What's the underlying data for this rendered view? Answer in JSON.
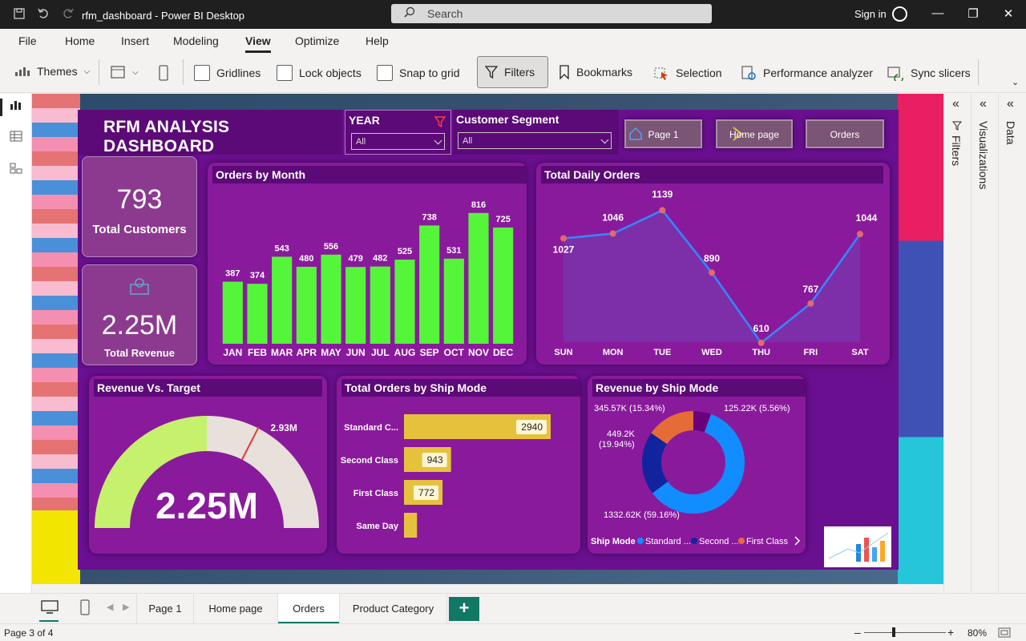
{
  "window": {
    "title": "rfm_dashboard - Power BI Desktop",
    "search_label": "Search",
    "signin_label": "Sign in"
  },
  "menu": [
    "File",
    "Home",
    "Insert",
    "Modeling",
    "View",
    "Optimize",
    "Help"
  ],
  "ribbon": {
    "themes": "Themes",
    "gridlines": "Gridlines",
    "lock_objects": "Lock objects",
    "snap_to_grid": "Snap to grid",
    "filters": "Filters",
    "bookmarks": "Bookmarks",
    "selection": "Selection",
    "performance": "Performance analyzer",
    "sync_slicers": "Sync slicers"
  },
  "report": {
    "title": "RFM ANALYSIS DASHBOARD",
    "year_slicer": {
      "label": "YEAR",
      "value": "All"
    },
    "segment_slicer": {
      "label": "Customer Segment",
      "value": "All"
    },
    "nav_buttons": [
      "Page 1",
      "Home page",
      "Orders"
    ],
    "kpi_customers": {
      "value": "793",
      "label": "Total Customers"
    },
    "kpi_revenue": {
      "value": "2.25M",
      "label": "Total Revenue"
    },
    "colors": {
      "bar_green": "#55f53a",
      "line_blue": "#3388ff",
      "gold": "#e6c23c",
      "panel": "#8a1a9c",
      "header": "#5c0a77"
    }
  },
  "chart_data": [
    {
      "type": "bar",
      "title": "Orders by Month",
      "categories": [
        "JAN",
        "FEB",
        "MAR",
        "APR",
        "MAY",
        "JUN",
        "JUL",
        "AUG",
        "SEP",
        "OCT",
        "NOV",
        "DEC"
      ],
      "values": [
        387,
        374,
        543,
        480,
        556,
        479,
        482,
        525,
        738,
        531,
        816,
        725
      ],
      "ylim": [
        0,
        850
      ]
    },
    {
      "type": "area",
      "title": "Total Daily Orders",
      "categories": [
        "SUN",
        "MON",
        "TUE",
        "WED",
        "THU",
        "FRI",
        "SAT"
      ],
      "values": [
        1027,
        1046,
        1139,
        890,
        610,
        767,
        1044
      ],
      "ylim": [
        600,
        1150
      ]
    },
    {
      "type": "gauge",
      "title": "Revenue Vs. Target",
      "value": 2.25,
      "value_label": "2.25M",
      "target": 2.93,
      "target_label": "2.93M",
      "max": 4.5
    },
    {
      "type": "bar",
      "title": "Total Orders by Ship Mode",
      "orientation": "horizontal",
      "categories": [
        "Standard C...",
        "Second Class",
        "First Class",
        "Same Day"
      ],
      "values": [
        2940,
        943,
        772,
        261
      ],
      "data_labels": [
        "2940",
        "943",
        "772",
        ""
      ]
    },
    {
      "type": "pie",
      "title": "Revenue by Ship Mode",
      "labels": [
        "Standard Class",
        "Second Class",
        "First Class",
        "Same Day"
      ],
      "values": [
        1332.62,
        449.2,
        345.57,
        125.22
      ],
      "value_labels": [
        "1332.62K (59.16%)",
        "449.2K (19.94%)",
        "345.57K (15.34%)",
        "125.22K (5.56%)"
      ],
      "colors": [
        "#118dff",
        "#12239e",
        "#e66c37",
        "#6b007b"
      ],
      "legend_title": "Ship Mode",
      "legend_entries": [
        "Standard ...",
        "Second ...",
        "First Class"
      ]
    }
  ],
  "panes": {
    "filters": "Filters",
    "visualizations": "Visualizations",
    "data": "Data"
  },
  "page_tabs": [
    "Page 1",
    "Home page",
    "Orders",
    "Product Category"
  ],
  "status": {
    "page": "Page 3 of 4",
    "zoom": "80%"
  }
}
